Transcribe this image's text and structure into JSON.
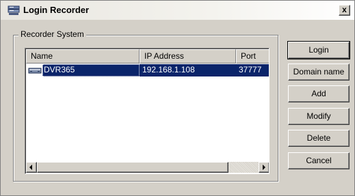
{
  "window": {
    "title": "Login Recorder",
    "title_icon": "recorder-icon",
    "close_label": "x"
  },
  "group": {
    "label": "Recorder System"
  },
  "list": {
    "columns": [
      "Name",
      "IP Address",
      "Port"
    ],
    "rows": [
      {
        "icon": "dvr-device-icon",
        "name": "DVR365",
        "ip": "192.168.1.108",
        "port": "37777"
      }
    ],
    "selected_row": 0
  },
  "buttons": {
    "login": "Login",
    "domain_name": "Domain name",
    "add": "Add",
    "modify": "Modify",
    "delete": "Delete",
    "cancel": "Cancel"
  },
  "colors": {
    "face": "#d4d0c8",
    "selection": "#0a246a",
    "selection_text": "#ffffff"
  }
}
